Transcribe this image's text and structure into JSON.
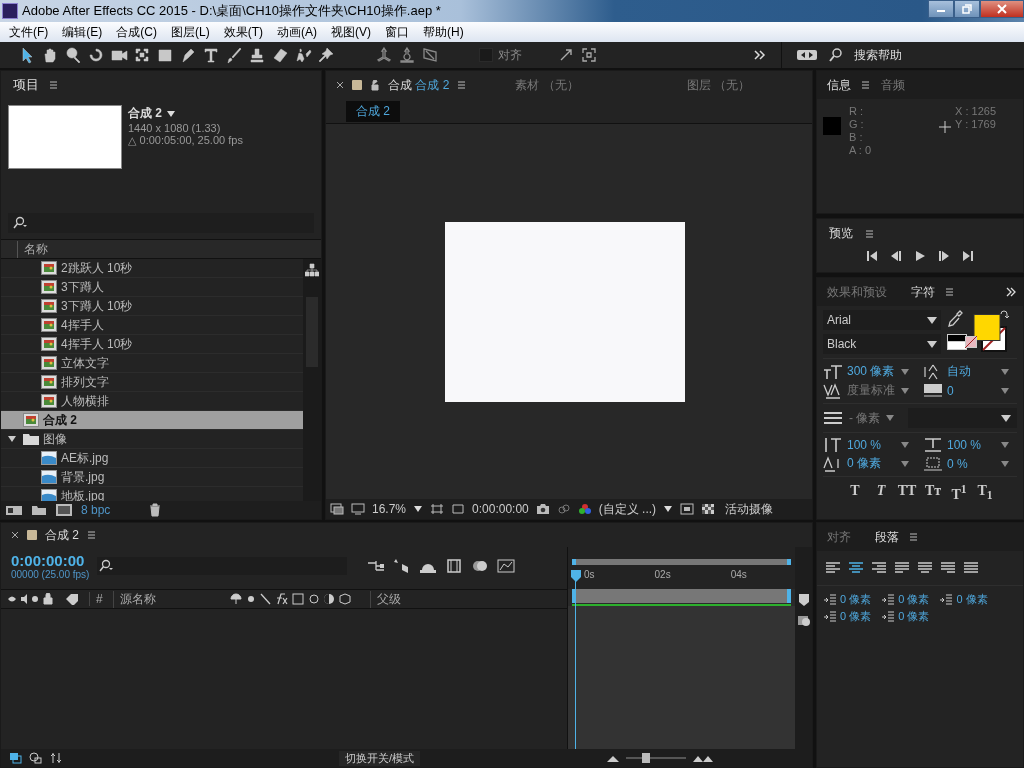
{
  "window": {
    "title": "Adobe After Effects CC 2015 - D:\\桌面\\CH10操作文件夹\\CH10操作.aep *"
  },
  "menu": [
    "文件(F)",
    "编辑(E)",
    "合成(C)",
    "图层(L)",
    "效果(T)",
    "动画(A)",
    "视图(V)",
    "窗口",
    "帮助(H)"
  ],
  "toolbar": {
    "snap_label": "对齐",
    "snap_checked": false,
    "search_label": "搜索帮助"
  },
  "project": {
    "title": "项目",
    "comp_name": "合成 2",
    "comp_size": "1440 x 1080 (1.33)",
    "comp_duration": "△ 0:00:05:00, 25.00 fps",
    "column": "名称",
    "items": [
      {
        "kind": "continued",
        "children": [
          {
            "kind": "comp",
            "name": "2跳跃人 10秒",
            "selected": false
          },
          {
            "kind": "comp",
            "name": "3下蹲人",
            "selected": false
          },
          {
            "kind": "comp",
            "name": "3下蹲人 10秒",
            "selected": false
          },
          {
            "kind": "comp",
            "name": "4挥手人",
            "selected": false
          },
          {
            "kind": "comp",
            "name": "4挥手人 10秒",
            "selected": false
          },
          {
            "kind": "comp",
            "name": "立体文字",
            "selected": false
          },
          {
            "kind": "comp",
            "name": "排列文字",
            "selected": false
          },
          {
            "kind": "comp",
            "name": "人物横排",
            "selected": false
          }
        ]
      },
      {
        "kind": "comp",
        "name": "合成 2",
        "selected": true
      },
      {
        "kind": "folder",
        "name": "图像",
        "selected": false,
        "expanded": true,
        "children": [
          {
            "kind": "image",
            "name": "AE标.jpg",
            "selected": false
          },
          {
            "kind": "image",
            "name": "背景.jpg",
            "selected": false
          },
          {
            "kind": "image",
            "name": "地板.jpg",
            "selected": false
          }
        ]
      }
    ],
    "bpc": "8 bpc"
  },
  "viewer": {
    "tabs": [
      {
        "label": "合成",
        "sub": "合成 2",
        "selected": true
      },
      {
        "label": "素材 （无）",
        "selected": false
      },
      {
        "label": "图层 （无）",
        "selected": false
      }
    ],
    "breadcrumb": "合成 2",
    "zoom": "16.7%",
    "time": "0:00:00:00",
    "view": "(自定义 ...)",
    "camera": "活动摄像"
  },
  "info": {
    "tabs": [
      {
        "label": "信息",
        "selected": true
      },
      {
        "label": "音频",
        "selected": false
      }
    ],
    "channels": [
      "R :",
      "G :",
      "B :",
      "A : 0"
    ],
    "coords": [
      "X : 1265",
      "Y : 1769"
    ]
  },
  "preview": {
    "title": "预览"
  },
  "character": {
    "tabs": [
      {
        "label": "效果和预设",
        "selected": false
      },
      {
        "label": "字符",
        "selected": true
      }
    ],
    "font": "Arial",
    "style": "Black",
    "size": "300 像素",
    "leading": "自动",
    "kerning": "度量标准",
    "tracking": "0",
    "stroke": "- 像素",
    "vscale": "100 %",
    "hscale": "100 %",
    "baseline": "0 像素",
    "tsume": "0 %",
    "styles": [
      {
        "label": "T",
        "kind": "bold"
      },
      {
        "label": "T",
        "kind": "italic"
      },
      {
        "label": "TT",
        "kind": "caps"
      },
      {
        "label": "Tᴛ",
        "kind": "smallcaps"
      },
      {
        "label": "T$^{1}$",
        "kind": "super"
      },
      {
        "label": "T$_{1}$",
        "kind": "sub"
      }
    ]
  },
  "timeline": {
    "tab": "合成 2",
    "timecode": "0:00:00:00",
    "fps": "00000 (25.00 fps)",
    "columns": [
      "#",
      "源名称",
      "父级"
    ],
    "ruler": [
      "0s",
      "02s",
      "04s"
    ],
    "footer": "切换开关/模式",
    "zoom_slider": {
      "level": 0.3
    }
  },
  "paragraph": {
    "tabs": [
      {
        "label": "对齐",
        "selected": false
      },
      {
        "label": "段落",
        "selected": true
      }
    ],
    "indents": [
      "0 像素",
      "0 像素",
      "0 像素",
      "0 像素",
      "0 像素"
    ]
  }
}
